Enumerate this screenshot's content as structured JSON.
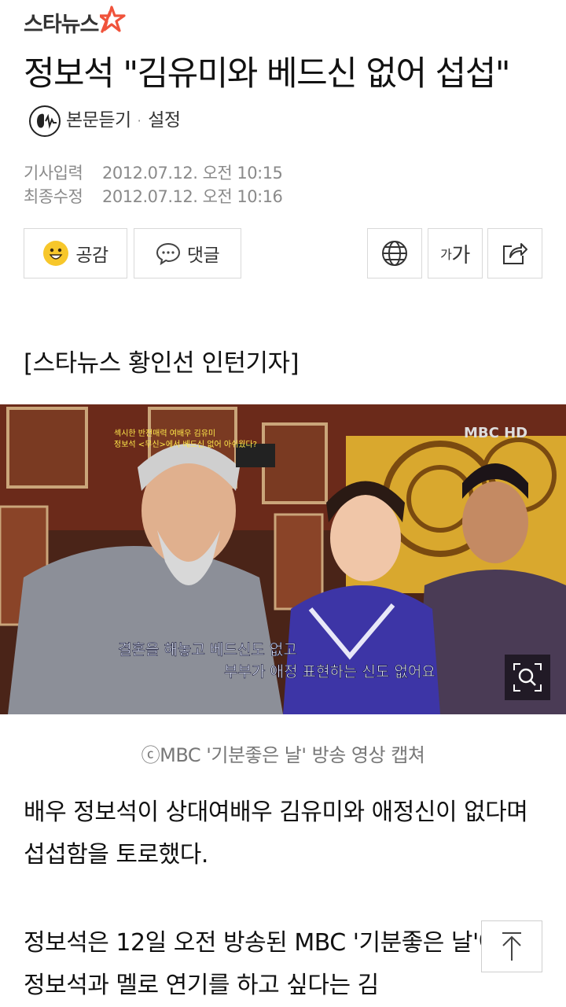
{
  "header": {
    "logo_text": "스타뉴스"
  },
  "article": {
    "title": "정보석 \"김유미와 베드신 없어 섭섭\"",
    "tts_label": "본문듣기",
    "tts_separator": "·",
    "tts_settings": "설정",
    "meta": {
      "published_key": "기사입력",
      "published_value": "2012.07.12. 오전 10:15",
      "modified_key": "최종수정",
      "modified_value": "2012.07.12. 오전 10:16"
    },
    "actions": {
      "like_label": "공감",
      "comment_label": "댓글",
      "font_label_small": "가",
      "font_label_large": "가"
    },
    "byline": "[스타뉴스 황인선 인턴기자]",
    "image": {
      "overlay_caption_line1": "결혼을 해놓고 베드신도 없고",
      "overlay_caption_line2": "부부가 애정 표현하는 신도 없어요",
      "top_caption_line1": "섹시한 반전매력 여배우 김유미",
      "top_caption_line2": "정보석 <무신>에서 베드신 없어 아쉬웠다?",
      "broadcaster_logo": "MBC HD"
    },
    "photo_credit": "ⓒMBC '기분좋은 날' 방송 영상 캡쳐",
    "paragraph1": "배우 정보석이 상대여배우 김유미와 애정신이 없다며 섭섭함을 토로했다.",
    "paragraph2": "정보석은 12일 오전 방송된 MBC '기분좋은 날'에서 정보석과 멜로 연기를 하고 싶다는 김"
  },
  "colors": {
    "logo_star": "#f0533b",
    "meta_text": "#8a8a8a",
    "emoji_yellow": "#f7c72b"
  },
  "icons": [
    "star-logo-icon",
    "tts-icon",
    "smile-emoji-icon",
    "comment-bubble-icon",
    "globe-icon",
    "share-icon",
    "zoom-icon",
    "scroll-top-arrow-icon"
  ]
}
